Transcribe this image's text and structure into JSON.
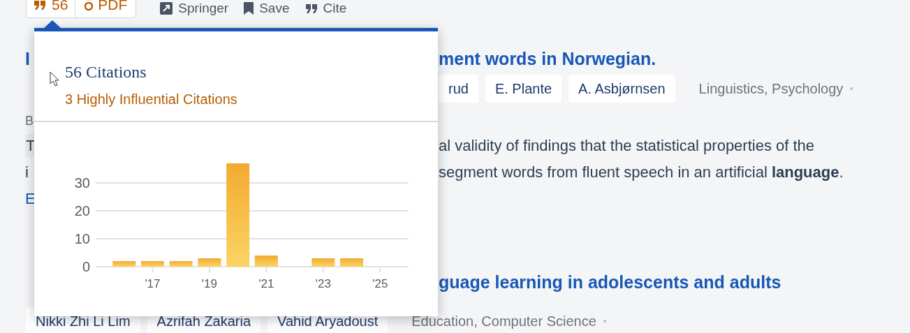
{
  "toolbar": {
    "citations_button": {
      "label": "56"
    },
    "pdf_button": {
      "label": "PDF"
    },
    "links": [
      {
        "kind": "external",
        "label": "Springer"
      },
      {
        "kind": "save",
        "label": "Save"
      },
      {
        "kind": "cite",
        "label": "Cite"
      }
    ]
  },
  "results": [
    {
      "title_left": "I",
      "title_right": "ment words in Norwegian.",
      "authors": [
        "rud",
        "E. Plante",
        "A. Asbjørnsen"
      ],
      "fields": "Linguistics, Psychology",
      "label_left": "B",
      "abstract_left": [
        "T",
        "i"
      ],
      "abstract_right": [
        "al validity of findings that the statistical properties of the",
        "segment words from fluent speech in an artificial **language**."
      ],
      "link_left": "E"
    },
    {
      "title_right": "guage learning in adolescents and adults",
      "authors": [
        "Nikki Zhi Li Lim",
        "Azrifah Zakaria",
        "Vahid Aryadoust"
      ],
      "fields": "Education, Computer Science"
    }
  ],
  "citations_popover": {
    "title": "56 Citations",
    "subtitle": "3 Highly Influential Citations",
    "chart_data": {
      "type": "bar",
      "x": [
        2016,
        2017,
        2018,
        2019,
        2020,
        2021,
        2022,
        2023,
        2024,
        2025
      ],
      "values": [
        2,
        2,
        2,
        3,
        37,
        4,
        0,
        3,
        3,
        0
      ],
      "xticks": [
        {
          "value": 2017,
          "label": "'17"
        },
        {
          "value": 2019,
          "label": "'19"
        },
        {
          "value": 2021,
          "label": "'21"
        },
        {
          "value": 2023,
          "label": "'23"
        },
        {
          "value": 2025,
          "label": "'25"
        }
      ],
      "xlim": [
        2015,
        2026
      ],
      "ylim": [
        0,
        37
      ],
      "yticks": [
        0,
        10,
        20,
        30
      ],
      "grid": true
    }
  }
}
